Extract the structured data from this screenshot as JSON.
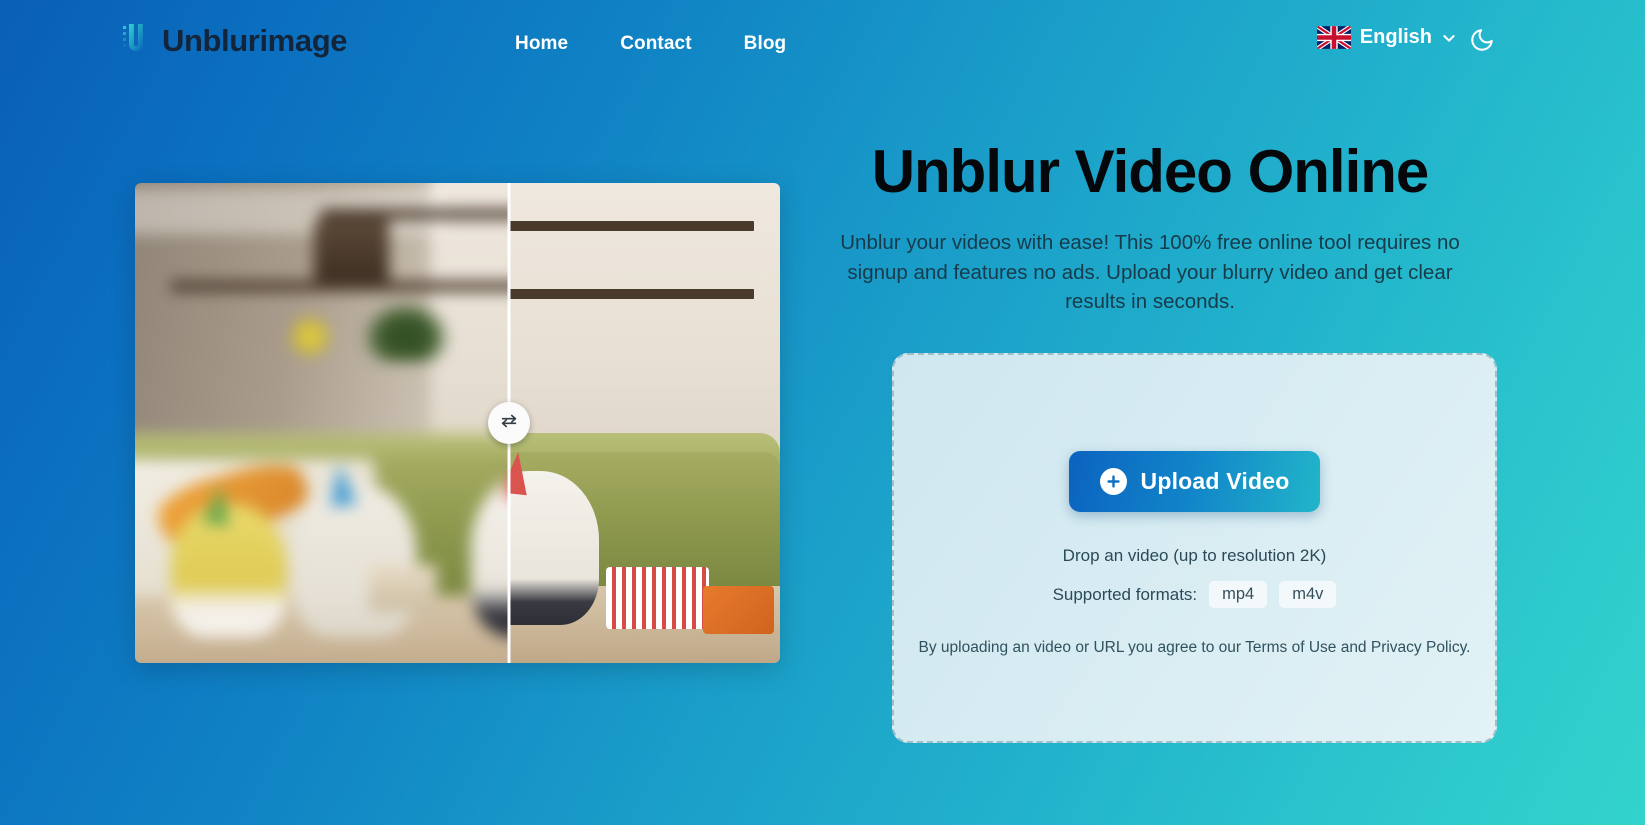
{
  "header": {
    "brand": {
      "name": "Unblurimage",
      "logo_icon": "u-logo-icon"
    },
    "nav": [
      {
        "label": "Home",
        "name": "nav-link-home"
      },
      {
        "label": "Contact",
        "name": "nav-link-contact"
      },
      {
        "label": "Blog",
        "name": "nav-link-blog"
      }
    ],
    "language": {
      "label": "English",
      "flag_icon": "uk-flag-icon",
      "chevron_icon": "chevron-down-icon"
    },
    "theme_toggle": {
      "icon": "moon-icon",
      "mode": "dark-mode"
    }
  },
  "comparison": {
    "handle_icon": "swap-arrows-icon",
    "before_label": "blurred",
    "after_label": "sharp",
    "divider_position": "58%"
  },
  "hero": {
    "title": "Unblur Video Online",
    "subtitle": "Unblur your videos with ease! This 100% free online tool requires no signup and features no ads. Upload your blurry video and get clear results in seconds."
  },
  "upload_card": {
    "button": {
      "label": "Upload Video",
      "icon": "plus-circle-icon"
    },
    "drop_text": "Drop an video (up to resolution 2K)",
    "formats_label": "Supported formats:",
    "formats": [
      "mp4",
      "m4v"
    ],
    "legal": "By uploading an video or URL you agree to our Terms of Use and Privacy Policy."
  },
  "colors": {
    "bg_start": "#0a5fb4",
    "bg_end": "#33d3cc",
    "button_start": "#0b63c0",
    "button_end": "#22b5c9",
    "card_bg": "#d7ecf2",
    "card_border": "#9fbfcb",
    "heading": "#06070a"
  }
}
